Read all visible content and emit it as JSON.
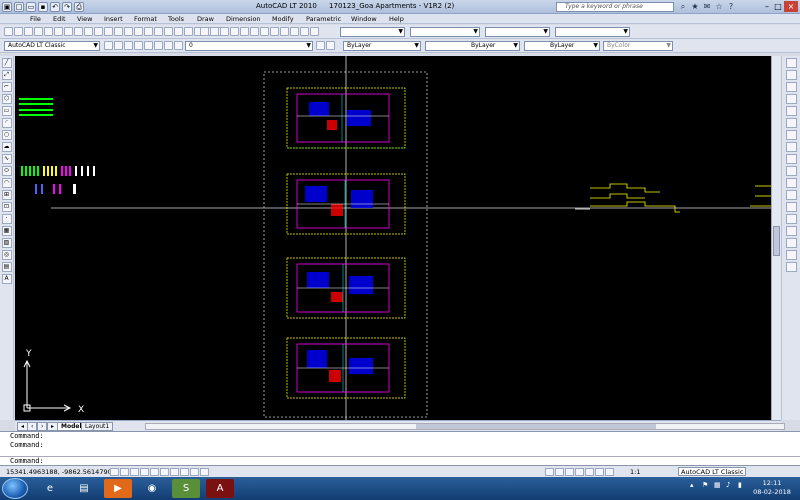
{
  "title": {
    "app": "AutoCAD LT 2010",
    "document": "170123_Goa Apartments - V1R2 (2)",
    "search_placeholder": "Type a keyword or phrase"
  },
  "menu": [
    "File",
    "Edit",
    "View",
    "Insert",
    "Format",
    "Tools",
    "Draw",
    "Dimension",
    "Modify",
    "Parametric",
    "Window",
    "Help"
  ],
  "toolbar": {
    "workspace": "AutoCAD LT Classic",
    "layer": "0",
    "color": "ByLayer",
    "linetype": "ByLayer",
    "lineweight": "ByLayer",
    "plotstyle": "ByColor"
  },
  "canvas": {
    "ucs_y": "Y",
    "ucs_x": "X",
    "background": "#000000",
    "accent_colors": [
      "#ff00ff",
      "#ffff00",
      "#0000ff",
      "#00ff00",
      "#ff0000",
      "#00ffff"
    ]
  },
  "tabs": [
    "Model",
    "Layout1"
  ],
  "command_lines": [
    "Command:",
    "Command:",
    "Command:"
  ],
  "status": {
    "coords": "15341.4963188, -9862.5614790",
    "annotation_scale": "1:1",
    "workspace": "AutoCAD LT Classic"
  },
  "taskbar": {
    "time": "12:11",
    "date": "08-02-2018",
    "apps": [
      "ie-icon",
      "explorer-icon",
      "media-player-icon",
      "chrome-icon",
      "sticky-icon",
      "autocad-icon"
    ]
  }
}
